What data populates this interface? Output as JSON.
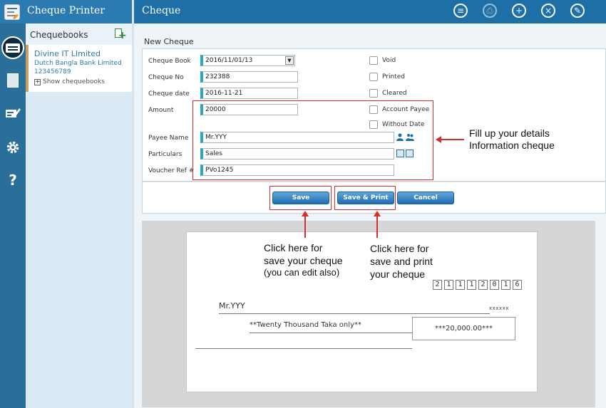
{
  "app": {
    "title": "Cheque Printer",
    "logo_text": "CHEQUE"
  },
  "header": {
    "title": "Cheque"
  },
  "header_buttons": [
    {
      "name": "menu",
      "icon": "≡"
    },
    {
      "name": "print",
      "icon": "⎙"
    },
    {
      "name": "add",
      "icon": "+"
    },
    {
      "name": "close",
      "icon": "×"
    },
    {
      "name": "edit",
      "icon": "✎"
    }
  ],
  "sidebar": {
    "help_icon": "?"
  },
  "chequebooks": {
    "title": "Chequebooks",
    "item": {
      "name": "Divine IT LImited",
      "bank": "Dutch Bangla Bank Limited",
      "account": "123456789"
    },
    "show_label": "Show chequebooks"
  },
  "form": {
    "section_title": "New Cheque",
    "labels": {
      "cheque_book": "Cheque Book",
      "cheque_no": "Cheque No",
      "cheque_date": "Cheque date",
      "amount": "Amount",
      "payee_name": "Payee Name",
      "particulars": "Particulars",
      "voucher_ref": "Voucher Ref #"
    },
    "values": {
      "cheque_book": "2016/11/01/13",
      "cheque_no": "232388",
      "cheque_date": "2016-11-21",
      "amount": "20000",
      "payee_name": "Mr.YYY",
      "particulars": "Sales",
      "voucher_ref": "PVo1245"
    },
    "checkboxes": {
      "void": "Void",
      "printed": "Printed",
      "cleared": "Cleared",
      "account_payee": "Account Payee",
      "without_date": "Without Date"
    }
  },
  "buttons": {
    "save": "Save",
    "save_print": "Save & Print",
    "cancel": "Cancel"
  },
  "annotations": {
    "fill_line1": "Fill up your details",
    "fill_line2": "Information cheque",
    "save_line1": "Click here for",
    "save_line2": "save your cheque",
    "save_line3": "(you can edit also)",
    "print_line1": "Click here for",
    "print_line2": "save and print",
    "print_line3": "your cheque"
  },
  "preview": {
    "date_digits": [
      "2",
      "1",
      "1",
      "1",
      "2",
      "0",
      "1",
      "6"
    ],
    "payee": "Mr.YYY",
    "payee_suffix": "xxxxxx",
    "amount_words": "**Twenty Thousand Taka only**",
    "amount_figure": "***20,000.00***"
  },
  "colors": {
    "header": "#1e6fa6",
    "sidebar": "#2a6e9a",
    "accent": "#2aa7c2",
    "annotation": "#d62d2d"
  }
}
